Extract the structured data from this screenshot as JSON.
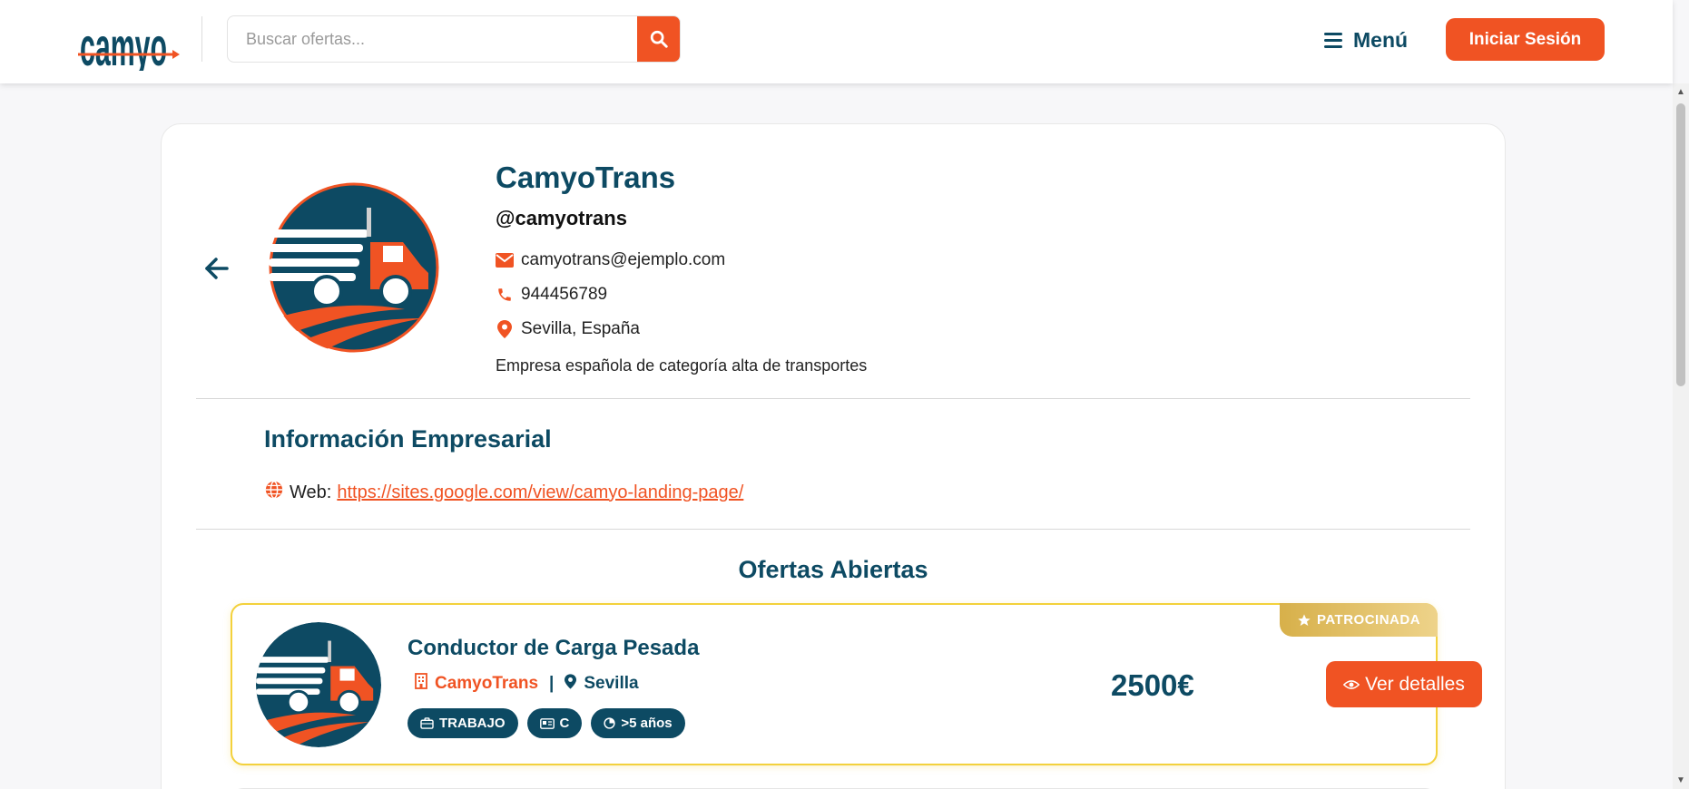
{
  "header": {
    "logo_text": "camyo",
    "search_placeholder": "Buscar ofertas...",
    "menu_label": "Menú",
    "login_label": "Iniciar Sesión"
  },
  "profile": {
    "name": "CamyoTrans",
    "handle": "@camyotrans",
    "email": "camyotrans@ejemplo.com",
    "phone": "944456789",
    "location": "Sevilla, España",
    "description": "Empresa española de categoría alta de transportes"
  },
  "business_info": {
    "title": "Información Empresarial",
    "web_label": "Web:",
    "web_url": "https://sites.google.com/view/camyo-landing-page/"
  },
  "offers": {
    "title": "Ofertas Abiertas",
    "items": [
      {
        "badge": "PATROCINADA",
        "title": "Conductor de Carga Pesada",
        "company": "CamyoTrans",
        "separator": "|",
        "city": "Sevilla",
        "tags": [
          "TRABAJO",
          "C",
          ">5 años"
        ],
        "price": "2500€",
        "details_label": "Ver detalles"
      }
    ]
  },
  "colors": {
    "brand_orange": "#f05323",
    "brand_navy": "#0d4a63",
    "sponsored_gold": "#d7b04a",
    "offer_border": "#f3d13c"
  }
}
